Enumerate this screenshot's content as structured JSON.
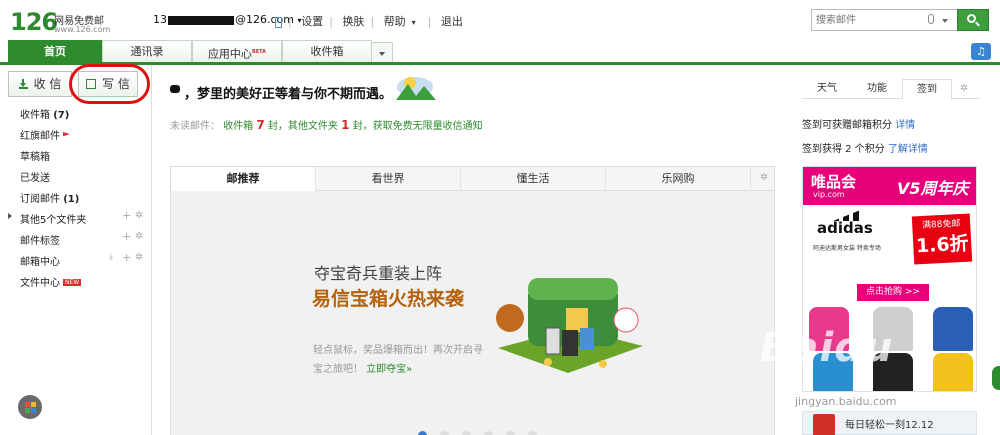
{
  "header": {
    "logo_num": "126",
    "logo_name": "网易免费邮",
    "logo_url": "www.126.com",
    "account_prefix": "13",
    "account_suffix": "@126.com",
    "links": [
      "设置",
      "换肤",
      "帮助",
      "退出"
    ],
    "search_placeholder": "搜索邮件"
  },
  "tabs": [
    {
      "label": "首页",
      "active": true
    },
    {
      "label": "通讯录"
    },
    {
      "label": "应用中心",
      "badge": "BETA"
    },
    {
      "label": "收件箱"
    }
  ],
  "sidebar": {
    "receive_label": "收 信",
    "compose_label": "写 信",
    "items": [
      {
        "label": "收件箱",
        "count": "(7)"
      },
      {
        "label": "红旗邮件"
      },
      {
        "label": "草稿箱"
      },
      {
        "label": "已发送"
      },
      {
        "label": "订阅邮件",
        "count": "(1)"
      },
      {
        "label": "其他5个文件夹"
      },
      {
        "label": "邮件标签"
      },
      {
        "label": "邮箱中心"
      },
      {
        "label": "文件中心",
        "badge": "NEW"
      }
    ]
  },
  "main": {
    "greeting": "，梦里的美好正等着与你不期而遇。",
    "unread": {
      "label": "未读邮件：",
      "inbox_text": "收件箱",
      "inbox_count": "7",
      "unit": "封",
      "other_text": "，其他文件夹",
      "other_count": "1",
      "unit2": "封",
      "cta": "，获取免费无限量收信通知"
    },
    "rec_tabs": [
      "邮推荐",
      "看世界",
      "懂生活",
      "乐网购"
    ],
    "promo": {
      "line1": "夺宝奇兵重装上阵",
      "line2": "易信宝箱火热来袭",
      "desc": "轻点鼠标，奖品爆箱而出！再次开启寻宝之旅吧！",
      "link": "立即夺宝»"
    }
  },
  "right": {
    "tabs": [
      "天气",
      "功能",
      "签到"
    ],
    "line1_text": "签到可获赠邮箱积分",
    "line1_link": "详情",
    "line2_text": "签到获得 2 个积分",
    "line2_link": "了解详情",
    "ad": {
      "brand": "唯品会",
      "site": "vip.com",
      "title": "V5周年庆",
      "adidas": "adidas",
      "sub": "阿迪达斯男女装 特卖专场",
      "price_top": "满88免邮",
      "price": "1.6折",
      "btn": "点击抢购 >>"
    },
    "daily": "每日轻松一刻12.12"
  },
  "watermark": "Baidu",
  "watermark_sub": "jingyan.baidu.com",
  "colors": {
    "brand_green": "#2e8a2e",
    "alert_red": "#d0302a",
    "vip_pink": "#e6007a"
  }
}
